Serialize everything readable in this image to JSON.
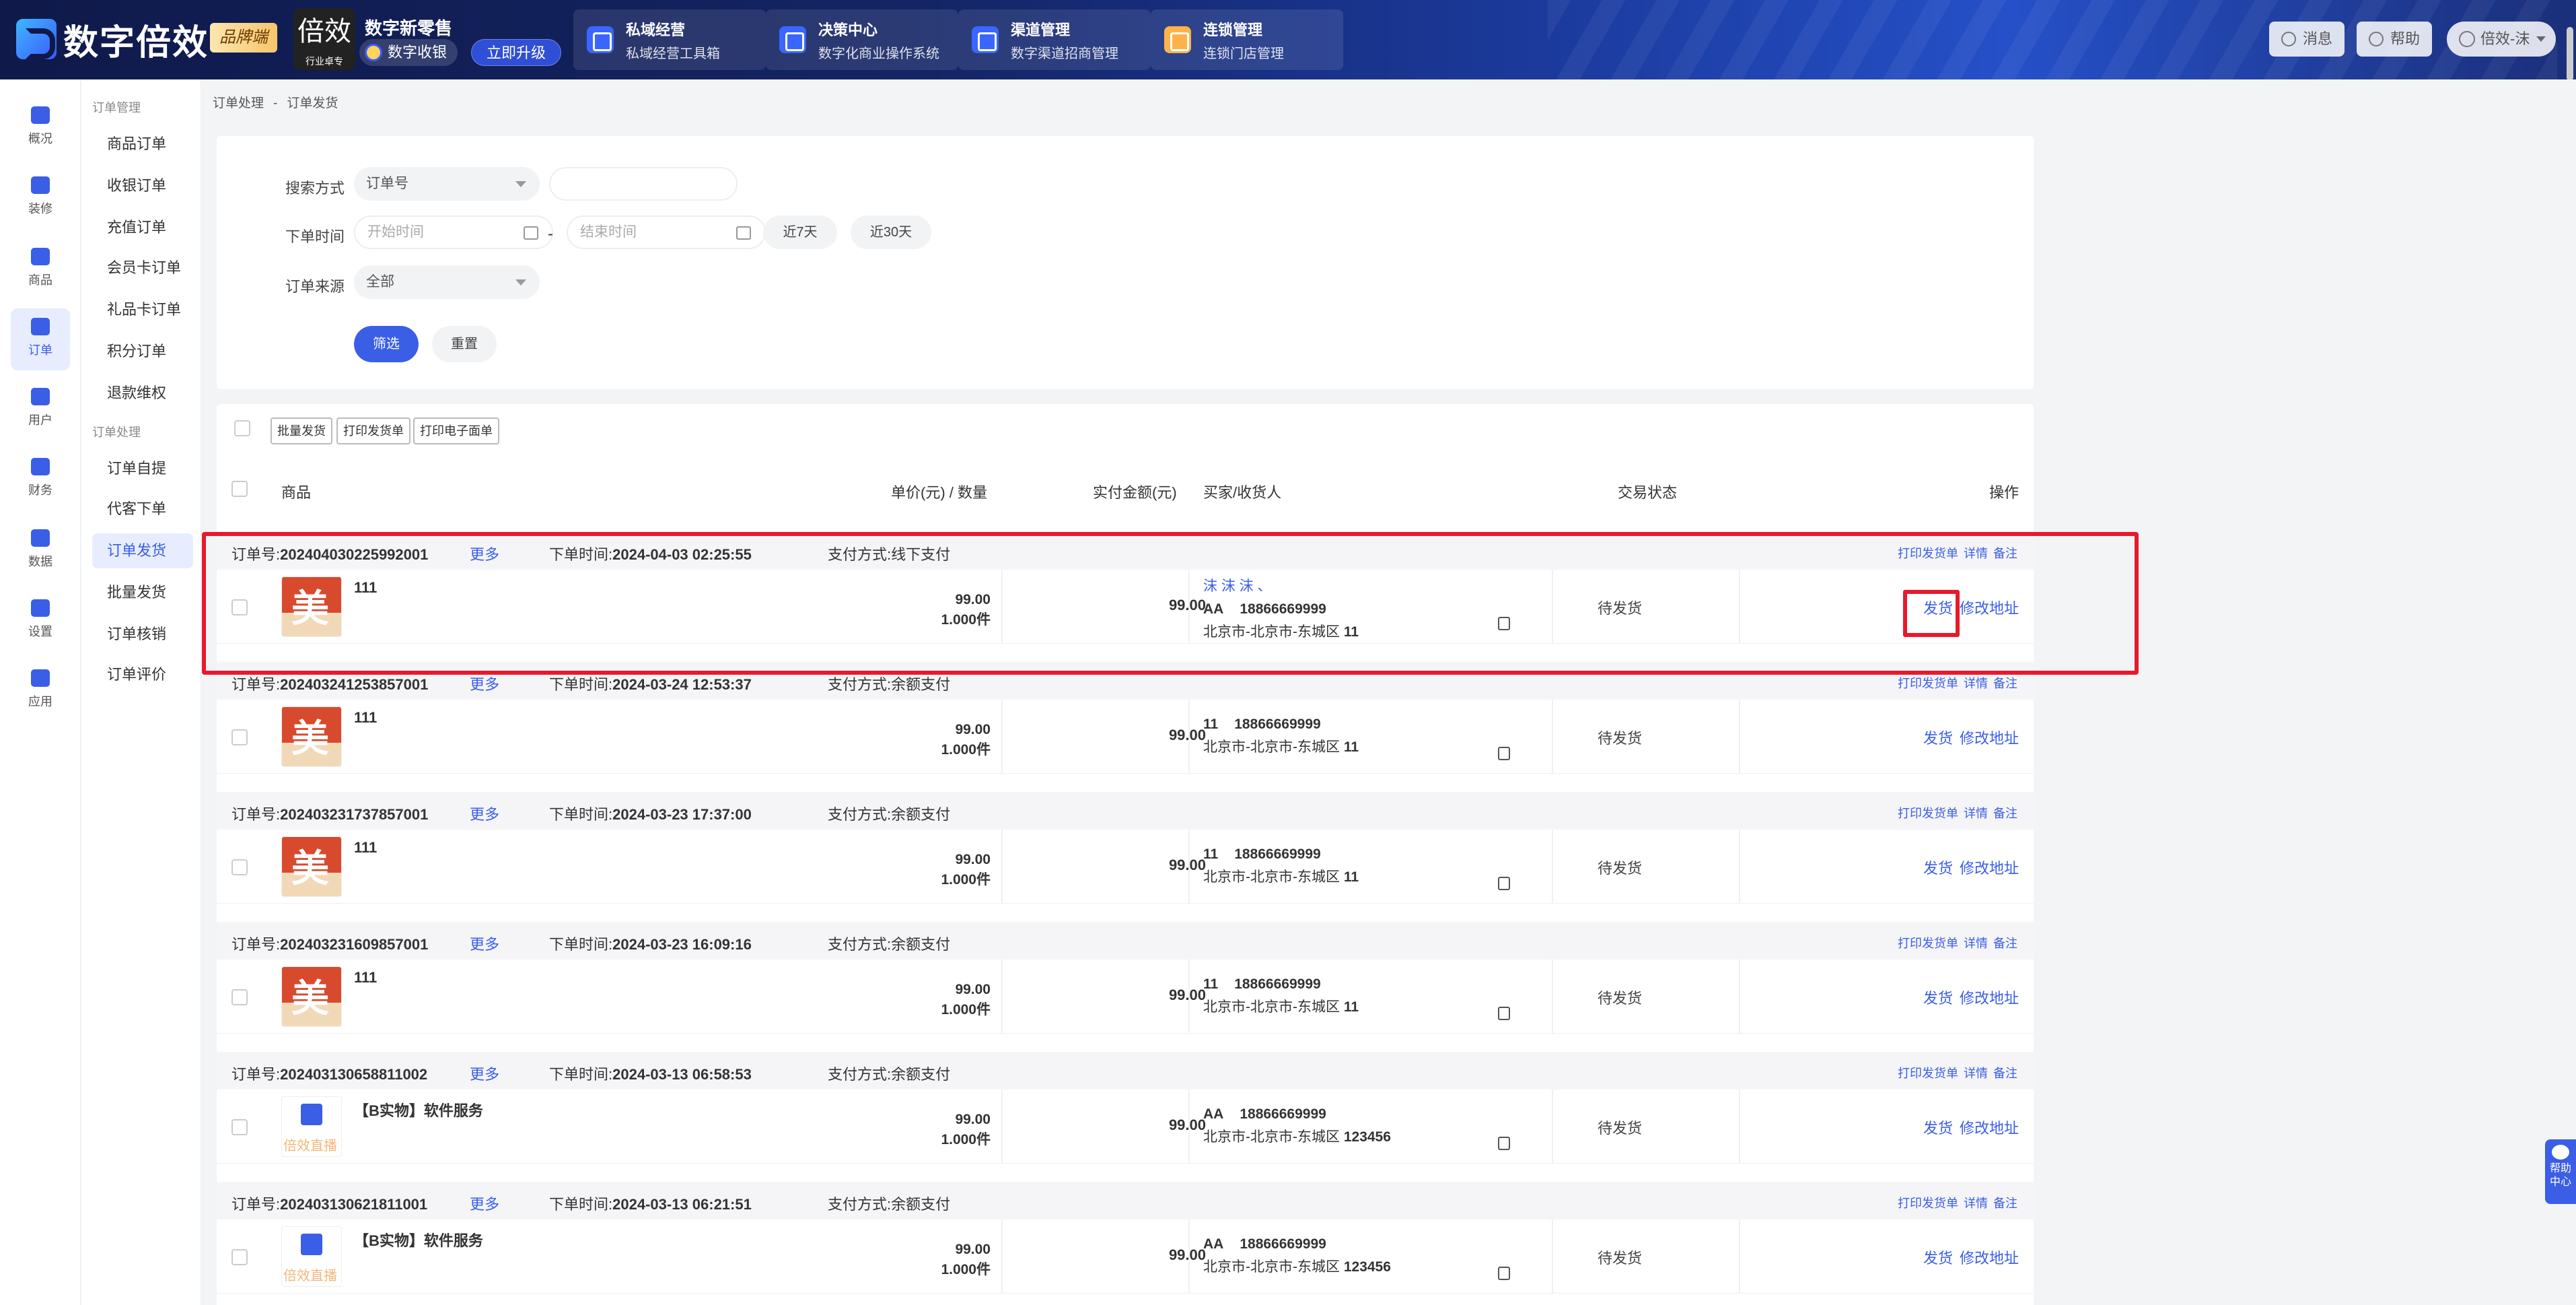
{
  "topbar": {
    "logo_text": "数字倍效",
    "brand_badge": "品牌端",
    "store_avatar_text": "倍效",
    "store_avatar_sub": "行业卓专",
    "store_name": "数字新零售",
    "store_chip": "数字收银",
    "upgrade": "立即升级",
    "modules": [
      {
        "title": "私域经营",
        "sub": "私域经营工具箱"
      },
      {
        "title": "决策中心",
        "sub": "数字化商业操作系统"
      },
      {
        "title": "渠道管理",
        "sub": "数字渠道招商管理"
      },
      {
        "title": "连锁管理",
        "sub": "连锁门店管理"
      }
    ],
    "message": "消息",
    "help": "帮助",
    "user": "倍效-沫"
  },
  "rail": [
    {
      "label": "概况",
      "icon": "overview-icon"
    },
    {
      "label": "装修",
      "icon": "decorate-icon"
    },
    {
      "label": "商品",
      "icon": "goods-icon"
    },
    {
      "label": "订单",
      "icon": "order-icon"
    },
    {
      "label": "用户",
      "icon": "user-icon"
    },
    {
      "label": "财务",
      "icon": "finance-icon"
    },
    {
      "label": "数据",
      "icon": "data-icon"
    },
    {
      "label": "设置",
      "icon": "settings-icon"
    },
    {
      "label": "应用",
      "icon": "apps-icon"
    }
  ],
  "submenu": {
    "group1": "订单管理",
    "items1": [
      "商品订单",
      "收银订单",
      "充值订单",
      "会员卡订单",
      "礼品卡订单",
      "积分订单",
      "退款维权"
    ],
    "group2": "订单处理",
    "items2": [
      "订单自提",
      "代客下单",
      "订单发货",
      "批量发货",
      "订单核销",
      "订单评价"
    ]
  },
  "breadcrumb": {
    "level1": "订单处理",
    "sep": "-",
    "level2": "订单发货"
  },
  "filter": {
    "search_label": "搜索方式",
    "search_type": "订单号",
    "search_value": "",
    "time_label": "下单时间",
    "start_placeholder": "开始时间",
    "end_placeholder": "结束时间",
    "dash": "-",
    "last7": "近7天",
    "last30": "近30天",
    "source_label": "订单来源",
    "source_value": "全部",
    "filter_btn": "筛选",
    "reset_btn": "重置"
  },
  "bulk": {
    "ship": "批量发货",
    "print_ship": "打印发货单",
    "print_waybill": "打印电子面单"
  },
  "columns": {
    "goods": "商品",
    "price_qty": "单价(元) / 数量",
    "paid": "实付金额(元)",
    "buyer": "买家/收货人",
    "status": "交易状态",
    "ops": "操作"
  },
  "labels": {
    "order_no": "订单号:",
    "more": "更多",
    "order_time": "下单时间:",
    "pay_method": "支付方式:",
    "print": "打印发货单",
    "detail": "详情",
    "note": "备注",
    "ship": "发货",
    "edit_addr": "修改地址"
  },
  "orders": [
    {
      "no": "202404030225992001",
      "time": "2024-04-03 02:25:55",
      "pay": "线下支付",
      "product": "111",
      "thumb": "mei",
      "price": "99.00",
      "qty": "1.000件",
      "amount": "99.00",
      "buyer_nick": "沫 沫 沫 、",
      "name": "AA",
      "phone": "18866669999",
      "addr": "北京市-北京市-东城区",
      "addr_detail": "11",
      "status": "待发货"
    },
    {
      "no": "202403241253857001",
      "time": "2024-03-24 12:53:37",
      "pay": "余额支付",
      "product": "111",
      "thumb": "mei",
      "price": "99.00",
      "qty": "1.000件",
      "amount": "99.00",
      "buyer_nick": "",
      "name": "11",
      "phone": "18866669999",
      "addr": "北京市-北京市-东城区",
      "addr_detail": "11",
      "status": "待发货"
    },
    {
      "no": "202403231737857001",
      "time": "2024-03-23 17:37:00",
      "pay": "余额支付",
      "product": "111",
      "thumb": "mei",
      "price": "99.00",
      "qty": "1.000件",
      "amount": "99.00",
      "buyer_nick": "",
      "name": "11",
      "phone": "18866669999",
      "addr": "北京市-北京市-东城区",
      "addr_detail": "11",
      "status": "待发货"
    },
    {
      "no": "202403231609857001",
      "time": "2024-03-23 16:09:16",
      "pay": "余额支付",
      "product": "111",
      "thumb": "mei",
      "price": "99.00",
      "qty": "1.000件",
      "amount": "99.00",
      "buyer_nick": "",
      "name": "11",
      "phone": "18866669999",
      "addr": "北京市-北京市-东城区",
      "addr_detail": "11",
      "status": "待发货"
    },
    {
      "no": "202403130658811002",
      "time": "2024-03-13 06:58:53",
      "pay": "余额支付",
      "product": "【B实物】软件服务",
      "thumb": "soft",
      "price": "99.00",
      "qty": "1.000件",
      "amount": "99.00",
      "buyer_nick": "",
      "name": "AA",
      "phone": "18866669999",
      "addr": "北京市-北京市-东城区",
      "addr_detail": "123456",
      "status": "待发货"
    },
    {
      "no": "202403130621811001",
      "time": "2024-03-13 06:21:51",
      "pay": "余额支付",
      "product": "【B实物】软件服务",
      "thumb": "soft",
      "price": "99.00",
      "qty": "1.000件",
      "amount": "99.00",
      "buyer_nick": "",
      "name": "AA",
      "phone": "18866669999",
      "addr": "北京市-北京市-东城区",
      "addr_detail": "123456",
      "status": "待发货"
    }
  ],
  "help_float": "帮助中心",
  "colors": {
    "accent": "#3a5ee6",
    "highlight": "#e8192c"
  }
}
